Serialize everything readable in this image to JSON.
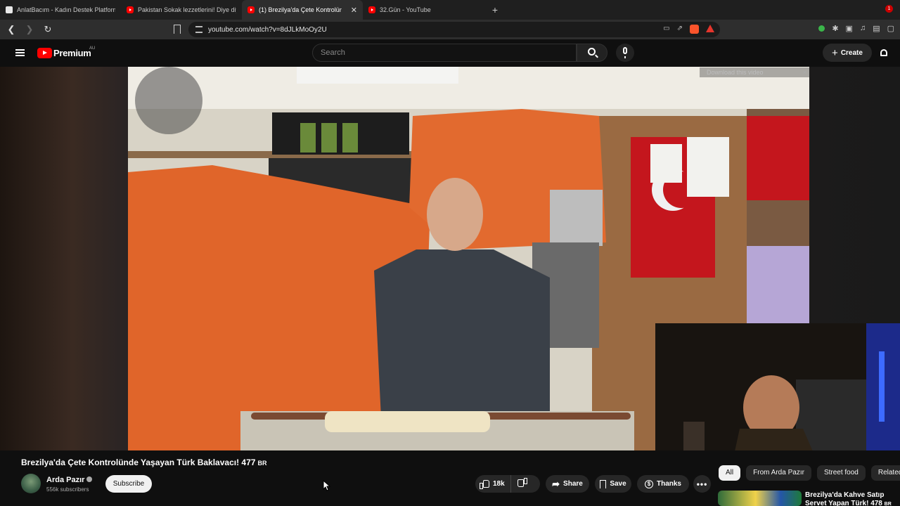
{
  "browser": {
    "tabs": [
      {
        "title": "AnlatBacım - Kadın Destek Platformu",
        "favicon": "page",
        "active": false
      },
      {
        "title": "Pakistan Sokak lezzetlerini! Diye diye",
        "favicon": "youtube",
        "active": false
      },
      {
        "title": "(1) Brezilya'da Çete Kontrolünde",
        "favicon": "youtube",
        "active": true
      },
      {
        "title": "32.Gün - YouTube",
        "favicon": "youtube",
        "active": false
      }
    ],
    "new_tab": "+",
    "minimize": "–",
    "url": "youtube.com/watch?v=8dJLkMoOy2U"
  },
  "youtube": {
    "brand": "Premium",
    "region": "AU",
    "search_placeholder": "Search",
    "create_label": "Create",
    "notification_count": "1"
  },
  "player": {
    "download_chip": "Download this video",
    "download_close": "×"
  },
  "video": {
    "title": "Brezilya'da Çete Kontrolünde Yaşayan Türk Baklavacı! 477",
    "title_badge": "BR",
    "channel": "Arda Pazır",
    "subscribers": "556k subscribers",
    "subscribe_label": "Subscribe",
    "likes": "18k",
    "share_label": "Share",
    "save_label": "Save",
    "thanks_label": "Thanks",
    "more_label": "•••"
  },
  "sidebar": {
    "chips": [
      {
        "label": "All",
        "active": true
      },
      {
        "label": "From Arda Pazır",
        "active": false
      },
      {
        "label": "Street food",
        "active": false
      },
      {
        "label": "Related",
        "active": false
      }
    ],
    "related": {
      "title": "Brezilya'da Kahve Satıp Servet Yapan Türk! 478",
      "badge": "BR"
    }
  }
}
